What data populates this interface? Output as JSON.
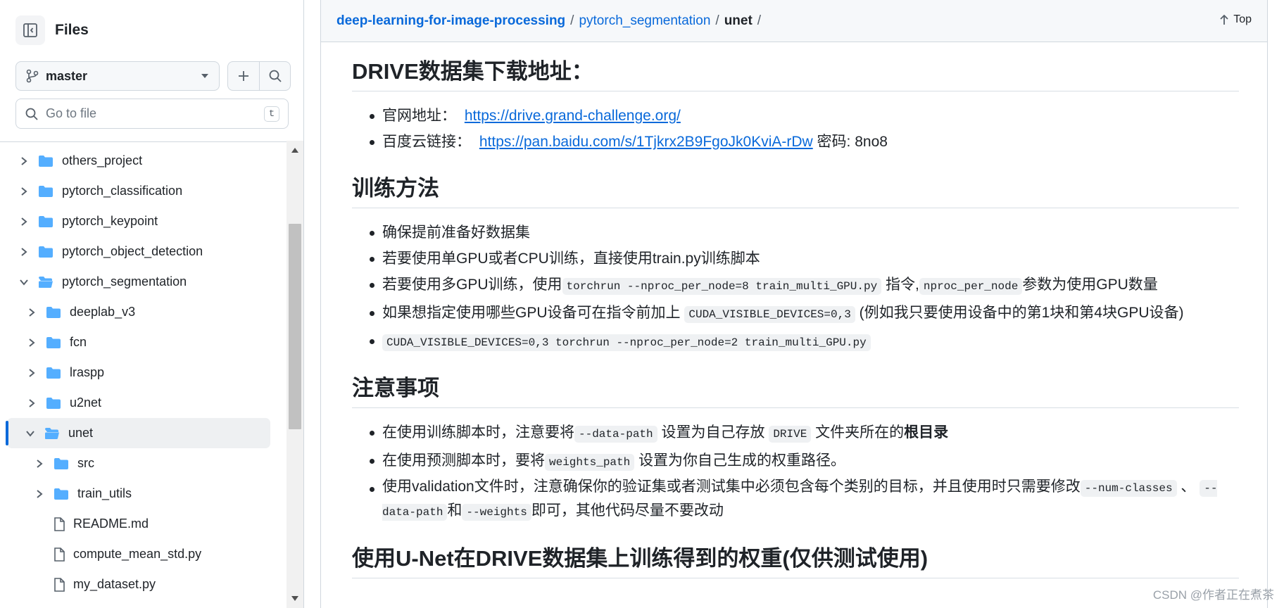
{
  "sidebar": {
    "title": "Files",
    "branch": "master",
    "search_placeholder": "Go to file",
    "search_shortcut": "t",
    "tree": [
      {
        "label": "others_project",
        "type": "folder",
        "level": 0,
        "expanded": false
      },
      {
        "label": "pytorch_classification",
        "type": "folder",
        "level": 0,
        "expanded": false
      },
      {
        "label": "pytorch_keypoint",
        "type": "folder",
        "level": 0,
        "expanded": false
      },
      {
        "label": "pytorch_object_detection",
        "type": "folder",
        "level": 0,
        "expanded": false
      },
      {
        "label": "pytorch_segmentation",
        "type": "folder",
        "level": 0,
        "expanded": true
      },
      {
        "label": "deeplab_v3",
        "type": "folder",
        "level": 1,
        "expanded": false
      },
      {
        "label": "fcn",
        "type": "folder",
        "level": 1,
        "expanded": false
      },
      {
        "label": "lraspp",
        "type": "folder",
        "level": 1,
        "expanded": false
      },
      {
        "label": "u2net",
        "type": "folder",
        "level": 1,
        "expanded": false
      },
      {
        "label": "unet",
        "type": "folder",
        "level": 1,
        "expanded": true,
        "active": true
      },
      {
        "label": "src",
        "type": "folder",
        "level": 2,
        "expanded": false
      },
      {
        "label": "train_utils",
        "type": "folder",
        "level": 2,
        "expanded": false
      },
      {
        "label": "README.md",
        "type": "file",
        "level": 2
      },
      {
        "label": "compute_mean_std.py",
        "type": "file",
        "level": 2
      },
      {
        "label": "my_dataset.py",
        "type": "file",
        "level": 2
      }
    ]
  },
  "breadcrumb": {
    "repo": "deep-learning-for-image-processing",
    "folder": "pytorch_segmentation",
    "current": "unet",
    "sep": "/"
  },
  "top_button": "Top",
  "sections": {
    "drive": {
      "title": "DRIVE数据集下载地址：",
      "official_label": "官网地址：",
      "official_url": "https://drive.grand-challenge.org/",
      "baidu_label": "百度云链接：",
      "baidu_url": "https://pan.baidu.com/s/1Tjkrx2B9FgoJk0KviA-rDw",
      "baidu_code": "密码: 8no8"
    },
    "train": {
      "title": "训练方法",
      "item1": "确保提前准备好数据集",
      "item2": "若要使用单GPU或者CPU训练，直接使用train.py训练脚本",
      "item3_a": "若要使用多GPU训练，使用",
      "item3_code1": "torchrun --nproc_per_node=8 train_multi_GPU.py",
      "item3_b": "指令,",
      "item3_code2": "nproc_per_node",
      "item3_c": "参数为使用GPU数量",
      "item4_a": "如果想指定使用哪些GPU设备可在指令前加上",
      "item4_code": "CUDA_VISIBLE_DEVICES=0,3",
      "item4_b": "(例如我只要使用设备中的第1块和第4块GPU设备)",
      "item5_code": "CUDA_VISIBLE_DEVICES=0,3 torchrun --nproc_per_node=2 train_multi_GPU.py"
    },
    "notes": {
      "title": "注意事项",
      "n1_a": "在使用训练脚本时，注意要将",
      "n1_code1": "--data-path",
      "n1_b": "设置为自己存放",
      "n1_code2": "DRIVE",
      "n1_c": "文件夹所在的",
      "n1_bold": "根目录",
      "n2_a": "在使用预测脚本时，要将",
      "n2_code": "weights_path",
      "n2_b": "设置为你自己生成的权重路径。",
      "n3_a": "使用validation文件时，注意确保你的验证集或者测试集中必须包含每个类别的目标，并且使用时只需要修改",
      "n3_code1": "--num-classes",
      "n3_b": "、",
      "n3_code2": "--data-path",
      "n3_c": "和",
      "n3_code3": "--weights",
      "n3_d": "即可，其他代码尽量不要改动"
    },
    "weights": {
      "title": "使用U-Net在DRIVE数据集上训练得到的权重(仅供测试使用)"
    }
  },
  "watermark": "CSDN @作者正在煮茶"
}
